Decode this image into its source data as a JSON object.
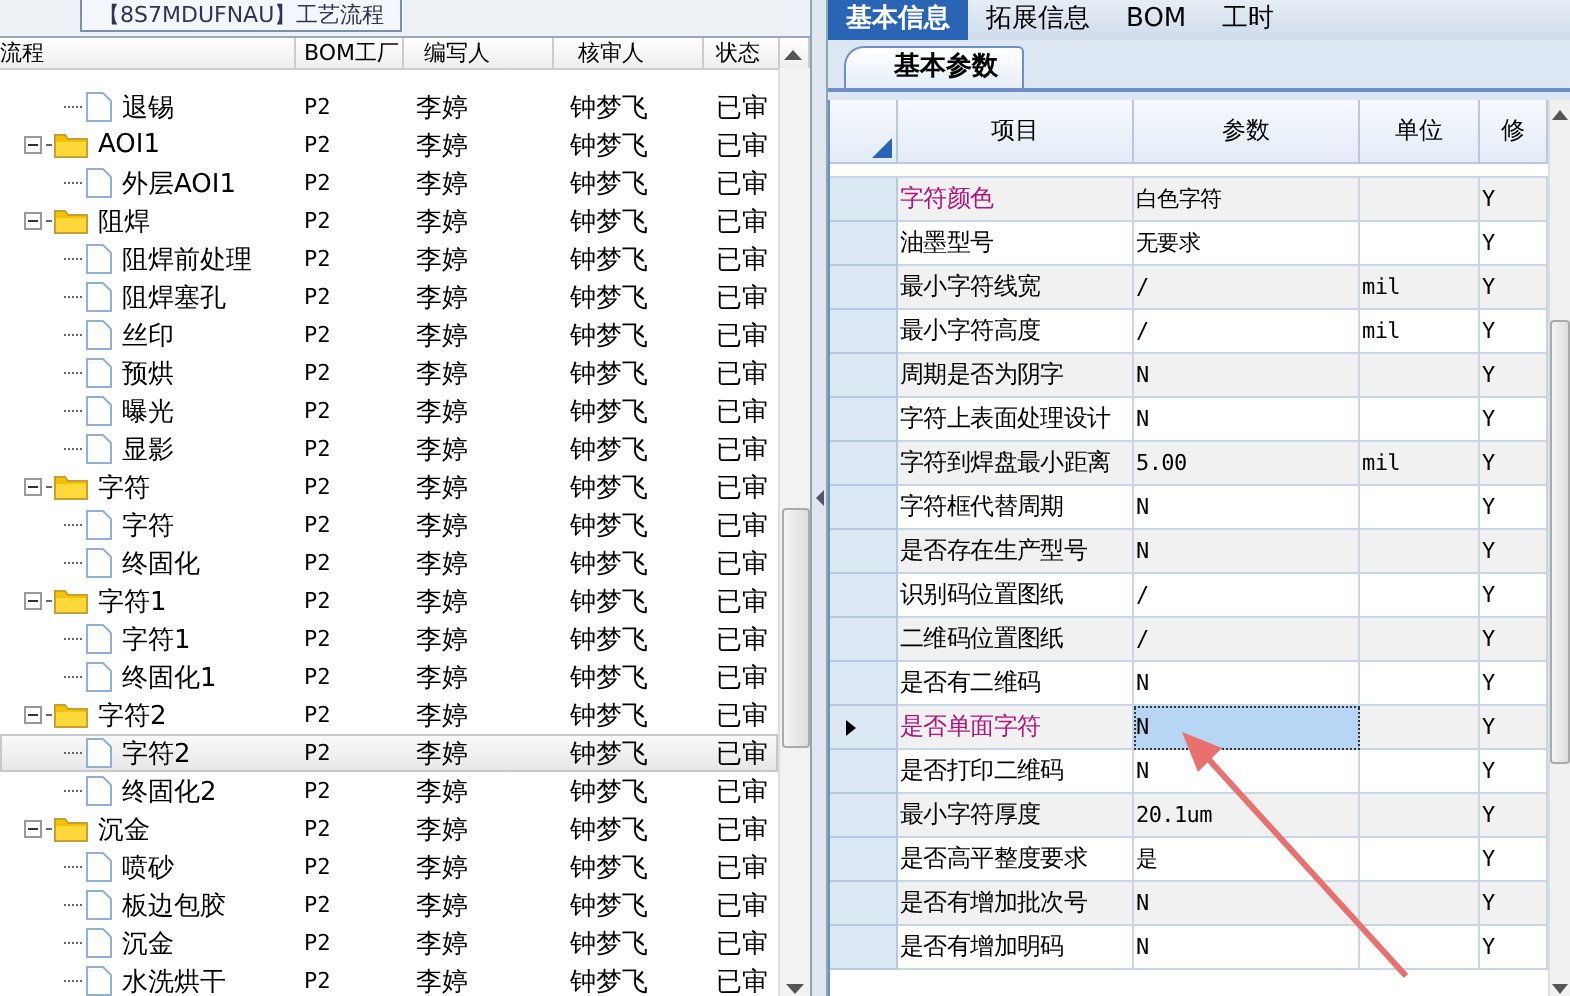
{
  "left_panel": {
    "tab": "【8S7MDUFNAU】工艺流程",
    "columns": [
      "流程",
      "BOM工厂",
      "编写人",
      "核审人",
      "状态"
    ],
    "continued_children": [
      {
        "kind": "file",
        "name": "退锡",
        "factory": "P2",
        "writer": "李婷",
        "reviewer": "钟梦飞",
        "status": "已审",
        "selected": false
      }
    ],
    "tree": [
      {
        "kind": "folder",
        "name": "AOI1",
        "factory": "P2",
        "writer": "李婷",
        "reviewer": "钟梦飞",
        "status": "已审",
        "selected": false,
        "expanded": true,
        "children": [
          {
            "kind": "file",
            "name": "外层AOI1",
            "factory": "P2",
            "writer": "李婷",
            "reviewer": "钟梦飞",
            "status": "已审",
            "selected": false
          }
        ]
      },
      {
        "kind": "folder",
        "name": "阻焊",
        "factory": "P2",
        "writer": "李婷",
        "reviewer": "钟梦飞",
        "status": "已审",
        "selected": false,
        "expanded": true,
        "children": [
          {
            "kind": "file",
            "name": "阻焊前处理",
            "factory": "P2",
            "writer": "李婷",
            "reviewer": "钟梦飞",
            "status": "已审",
            "selected": false
          },
          {
            "kind": "file",
            "name": "阻焊塞孔",
            "factory": "P2",
            "writer": "李婷",
            "reviewer": "钟梦飞",
            "status": "已审",
            "selected": false
          },
          {
            "kind": "file",
            "name": "丝印",
            "factory": "P2",
            "writer": "李婷",
            "reviewer": "钟梦飞",
            "status": "已审",
            "selected": false
          },
          {
            "kind": "file",
            "name": "预烘",
            "factory": "P2",
            "writer": "李婷",
            "reviewer": "钟梦飞",
            "status": "已审",
            "selected": false
          },
          {
            "kind": "file",
            "name": "曝光",
            "factory": "P2",
            "writer": "李婷",
            "reviewer": "钟梦飞",
            "status": "已审",
            "selected": false
          },
          {
            "kind": "file",
            "name": "显影",
            "factory": "P2",
            "writer": "李婷",
            "reviewer": "钟梦飞",
            "status": "已审",
            "selected": false
          }
        ]
      },
      {
        "kind": "folder",
        "name": "字符",
        "factory": "P2",
        "writer": "李婷",
        "reviewer": "钟梦飞",
        "status": "已审",
        "selected": false,
        "expanded": true,
        "children": [
          {
            "kind": "file",
            "name": "字符",
            "factory": "P2",
            "writer": "李婷",
            "reviewer": "钟梦飞",
            "status": "已审",
            "selected": false
          },
          {
            "kind": "file",
            "name": "终固化",
            "factory": "P2",
            "writer": "李婷",
            "reviewer": "钟梦飞",
            "status": "已审",
            "selected": false
          }
        ]
      },
      {
        "kind": "folder",
        "name": "字符1",
        "factory": "P2",
        "writer": "李婷",
        "reviewer": "钟梦飞",
        "status": "已审",
        "selected": false,
        "expanded": true,
        "children": [
          {
            "kind": "file",
            "name": "字符1",
            "factory": "P2",
            "writer": "李婷",
            "reviewer": "钟梦飞",
            "status": "已审",
            "selected": false
          },
          {
            "kind": "file",
            "name": "终固化1",
            "factory": "P2",
            "writer": "李婷",
            "reviewer": "钟梦飞",
            "status": "已审",
            "selected": false
          }
        ]
      },
      {
        "kind": "folder",
        "name": "字符2",
        "factory": "P2",
        "writer": "李婷",
        "reviewer": "钟梦飞",
        "status": "已审",
        "selected": false,
        "expanded": true,
        "children": [
          {
            "kind": "file",
            "name": "字符2",
            "factory": "P2",
            "writer": "李婷",
            "reviewer": "钟梦飞",
            "status": "已审",
            "selected": true
          },
          {
            "kind": "file",
            "name": "终固化2",
            "factory": "P2",
            "writer": "李婷",
            "reviewer": "钟梦飞",
            "status": "已审",
            "selected": false
          }
        ]
      },
      {
        "kind": "folder",
        "name": "沉金",
        "factory": "P2",
        "writer": "李婷",
        "reviewer": "钟梦飞",
        "status": "已审",
        "selected": false,
        "expanded": true,
        "children": [
          {
            "kind": "file",
            "name": "喷砂",
            "factory": "P2",
            "writer": "李婷",
            "reviewer": "钟梦飞",
            "status": "已审",
            "selected": false
          },
          {
            "kind": "file",
            "name": "板边包胶",
            "factory": "P2",
            "writer": "李婷",
            "reviewer": "钟梦飞",
            "status": "已审",
            "selected": false
          },
          {
            "kind": "file",
            "name": "沉金",
            "factory": "P2",
            "writer": "李婷",
            "reviewer": "钟梦飞",
            "status": "已审",
            "selected": false
          },
          {
            "kind": "file",
            "name": "水洗烘干",
            "factory": "P2",
            "writer": "李婷",
            "reviewer": "钟梦飞",
            "status": "已审",
            "selected": false
          }
        ]
      }
    ]
  },
  "right_panel": {
    "tabs": [
      {
        "label": "基本信息",
        "selected": true
      },
      {
        "label": "拓展信息",
        "selected": false
      },
      {
        "label": "BOM",
        "selected": false
      },
      {
        "label": "工时",
        "selected": false
      }
    ],
    "sub_tabs": [
      {
        "label": "基本参数",
        "selected": true
      }
    ],
    "columns": [
      "项目",
      "参数",
      "单位",
      "修"
    ],
    "rows": [
      {
        "item": "字符颜色",
        "param": "白色字符",
        "modify": "Y",
        "highlighted": true,
        "selected": false
      },
      {
        "item": "油墨型号",
        "param": "无要求",
        "modify": "Y",
        "highlighted": false,
        "selected": false
      },
      {
        "item": "最小字符线宽",
        "param": "/",
        "unit": "mil",
        "modify": "Y",
        "highlighted": false,
        "selected": false
      },
      {
        "item": "最小字符高度",
        "param": "/",
        "unit": "mil",
        "modify": "Y",
        "highlighted": false,
        "selected": false
      },
      {
        "item": "周期是否为阴字",
        "param": "N",
        "modify": "Y",
        "highlighted": false,
        "selected": false
      },
      {
        "item": "字符上表面处理设计",
        "param": "N",
        "modify": "Y",
        "highlighted": false,
        "selected": false
      },
      {
        "item": "字符到焊盘最小距离",
        "param": "5.00",
        "unit": "mil",
        "modify": "Y",
        "highlighted": false,
        "selected": false
      },
      {
        "item": "字符框代替周期",
        "param": "N",
        "modify": "Y",
        "highlighted": false,
        "selected": false
      },
      {
        "item": "是否存在生产型号",
        "param": "N",
        "modify": "Y",
        "highlighted": false,
        "selected": false
      },
      {
        "item": "识别码位置图纸",
        "param": "/",
        "modify": "Y",
        "highlighted": false,
        "selected": false
      },
      {
        "item": "二维码位置图纸",
        "param": "/",
        "modify": "Y",
        "highlighted": false,
        "selected": false
      },
      {
        "item": "是否有二维码",
        "param": "N",
        "modify": "Y",
        "highlighted": false,
        "selected": false
      },
      {
        "item": "是否单面字符",
        "param": "N",
        "modify": "Y",
        "highlighted": true,
        "selected": true
      },
      {
        "item": "是否打印二维码",
        "param": "N",
        "modify": "Y",
        "highlighted": false,
        "selected": false
      },
      {
        "item": "最小字符厚度",
        "param": "20.1um",
        "modify": "Y",
        "highlighted": false,
        "selected": false
      },
      {
        "item": "是否高平整度要求",
        "param": "是",
        "modify": "Y",
        "highlighted": false,
        "selected": false
      },
      {
        "item": "是否有增加批次号",
        "param": "N",
        "modify": "Y",
        "highlighted": false,
        "selected": false
      },
      {
        "item": "是否有增加明码",
        "param": "N",
        "modify": "Y",
        "highlighted": false,
        "selected": false
      }
    ]
  }
}
